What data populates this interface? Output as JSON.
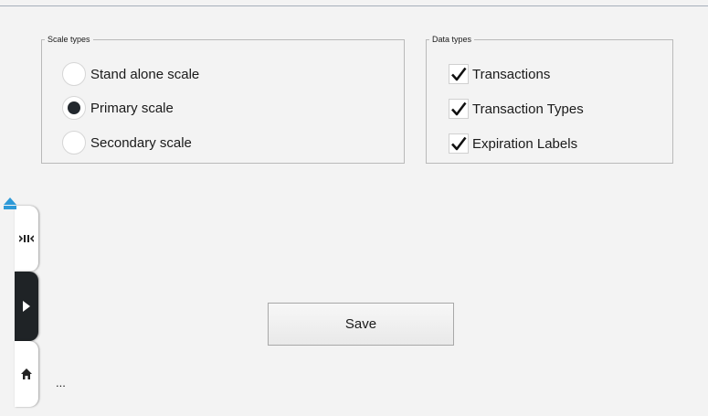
{
  "scale_types": {
    "legend": "Scale types",
    "options": [
      {
        "label": "Stand alone scale",
        "selected": false
      },
      {
        "label": "Primary scale",
        "selected": true
      },
      {
        "label": "Secondary scale",
        "selected": false
      }
    ]
  },
  "data_types": {
    "legend": "Data types",
    "options": [
      {
        "label": "Transactions",
        "checked": true
      },
      {
        "label": "Transaction Types",
        "checked": true
      },
      {
        "label": "Expiration Labels",
        "checked": true
      }
    ]
  },
  "save_button": {
    "label": "Save"
  },
  "status": {
    "ellipsis": "..."
  },
  "side_nav": {
    "icons": [
      "scale-icon",
      "play-icon",
      "home-icon"
    ]
  },
  "colors": {
    "background": "#f3f3f3",
    "dark_tab": "#1f2326",
    "accent": "#2e9ad8"
  }
}
